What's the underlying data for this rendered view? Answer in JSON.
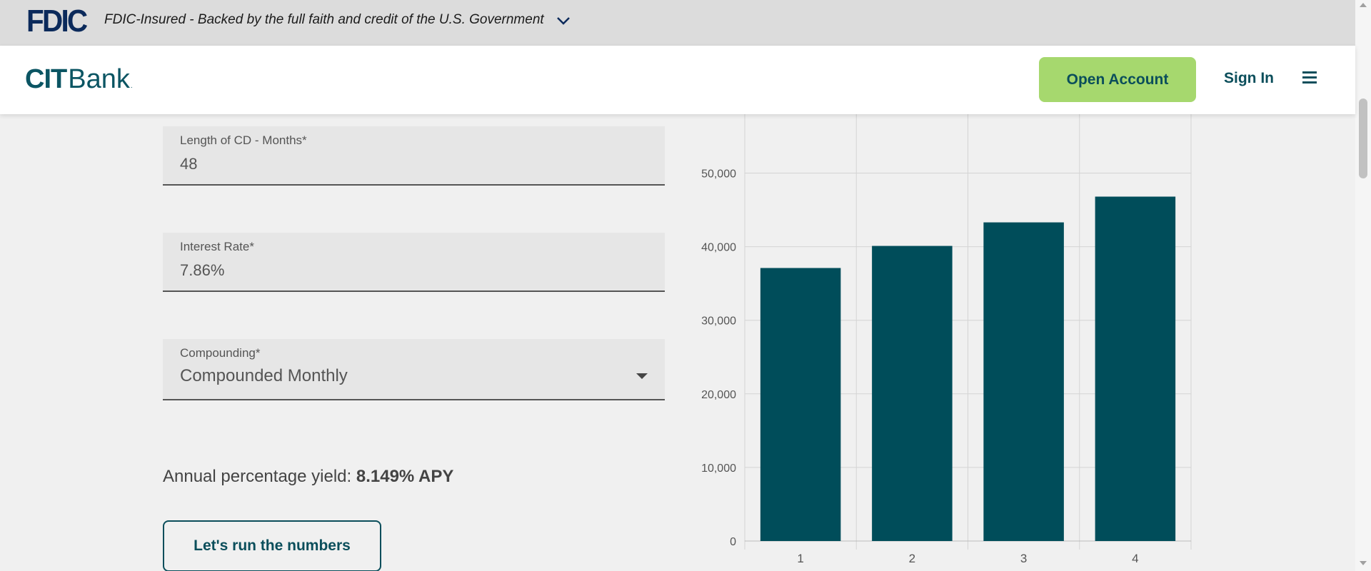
{
  "fdic_banner": {
    "logo": "FDIC",
    "text": "FDIC-Insured - Backed by the full faith and credit of the U.S. Government",
    "chevron_icon": "chevron-down-icon"
  },
  "header": {
    "logo_cit": "CIT",
    "logo_bank": "Bank",
    "logo_reg": ".",
    "open_account_label": "Open Account",
    "sign_in_label": "Sign In",
    "menu_icon": "hamburger-menu-icon"
  },
  "form": {
    "length": {
      "label": "Length of CD - Months*",
      "value": "48"
    },
    "rate": {
      "label": "Interest Rate*",
      "value": "7.86%"
    },
    "compounding": {
      "label": "Compounding*",
      "value": "Compounded Monthly"
    }
  },
  "apy": {
    "label": "Annual percentage yield: ",
    "value": "8.149% APY"
  },
  "run_button_label": "Let's run the numbers",
  "colors": {
    "brand_teal": "#004d5a",
    "open_account_bg": "#a6d86e",
    "fdic_navy": "#0b2a5b"
  },
  "chart_data": {
    "type": "bar",
    "categories": [
      "1",
      "2",
      "3",
      "4"
    ],
    "values": [
      37100,
      40100,
      43300,
      46800
    ],
    "yticks": [
      "0",
      "10,000",
      "20,000",
      "30,000",
      "40,000",
      "50,000"
    ],
    "ylim": [
      0,
      58000
    ],
    "grid": true,
    "color": "#004d5a"
  }
}
